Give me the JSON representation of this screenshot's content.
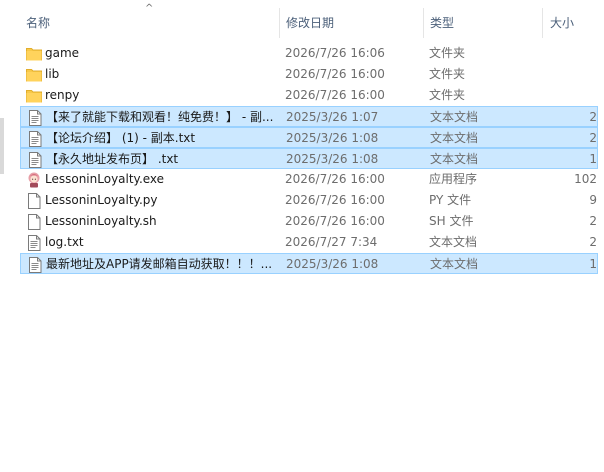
{
  "header": {
    "sort_indicator": "^",
    "col_name": "名称",
    "col_date": "修改日期",
    "col_type": "类型",
    "col_size": "大小"
  },
  "rows": [
    {
      "name": "game",
      "date": "2026/7/26 16:06",
      "type": "文件夹",
      "size": "",
      "icon": "folder-icon",
      "selected": false
    },
    {
      "name": "lib",
      "date": "2026/7/26 16:00",
      "type": "文件夹",
      "size": "",
      "icon": "folder-icon",
      "selected": false
    },
    {
      "name": "renpy",
      "date": "2026/7/26 16:00",
      "type": "文件夹",
      "size": "",
      "icon": "folder-icon",
      "selected": false
    },
    {
      "name": "【来了就能下载和观看！纯免费！】 - 副...",
      "date": "2025/3/26 1:07",
      "type": "文本文档",
      "size": "2",
      "icon": "text-file-icon",
      "selected": true
    },
    {
      "name": "【论坛介绍】 (1) - 副本.txt",
      "date": "2025/3/26 1:08",
      "type": "文本文档",
      "size": "2",
      "icon": "text-file-icon",
      "selected": true
    },
    {
      "name": "【永久地址发布页】 .txt",
      "date": "2025/3/26 1:08",
      "type": "文本文档",
      "size": "1",
      "icon": "text-file-icon",
      "selected": true
    },
    {
      "name": "LessoninLoyalty.exe",
      "date": "2026/7/26 16:00",
      "type": "应用程序",
      "size": "102",
      "icon": "app-exe-icon",
      "selected": false
    },
    {
      "name": "LessoninLoyalty.py",
      "date": "2026/7/26 16:00",
      "type": "PY 文件",
      "size": "9",
      "icon": "blank-file-icon",
      "selected": false
    },
    {
      "name": "LessoninLoyalty.sh",
      "date": "2026/7/26 16:00",
      "type": "SH 文件",
      "size": "2",
      "icon": "blank-file-icon",
      "selected": false
    },
    {
      "name": "log.txt",
      "date": "2026/7/27 7:34",
      "type": "文本文档",
      "size": "2",
      "icon": "text-file-icon",
      "selected": false
    },
    {
      "name": "最新地址及APP请发邮箱自动获取！！！...",
      "date": "2025/3/26 1:08",
      "type": "文本文档",
      "size": "1",
      "icon": "text-file-icon",
      "selected": true
    }
  ],
  "colors": {
    "selection_fill": "#cce8ff",
    "selection_border": "#99d1ff",
    "folder_yellow": "#ffd35c",
    "header_text": "#4c607a"
  }
}
